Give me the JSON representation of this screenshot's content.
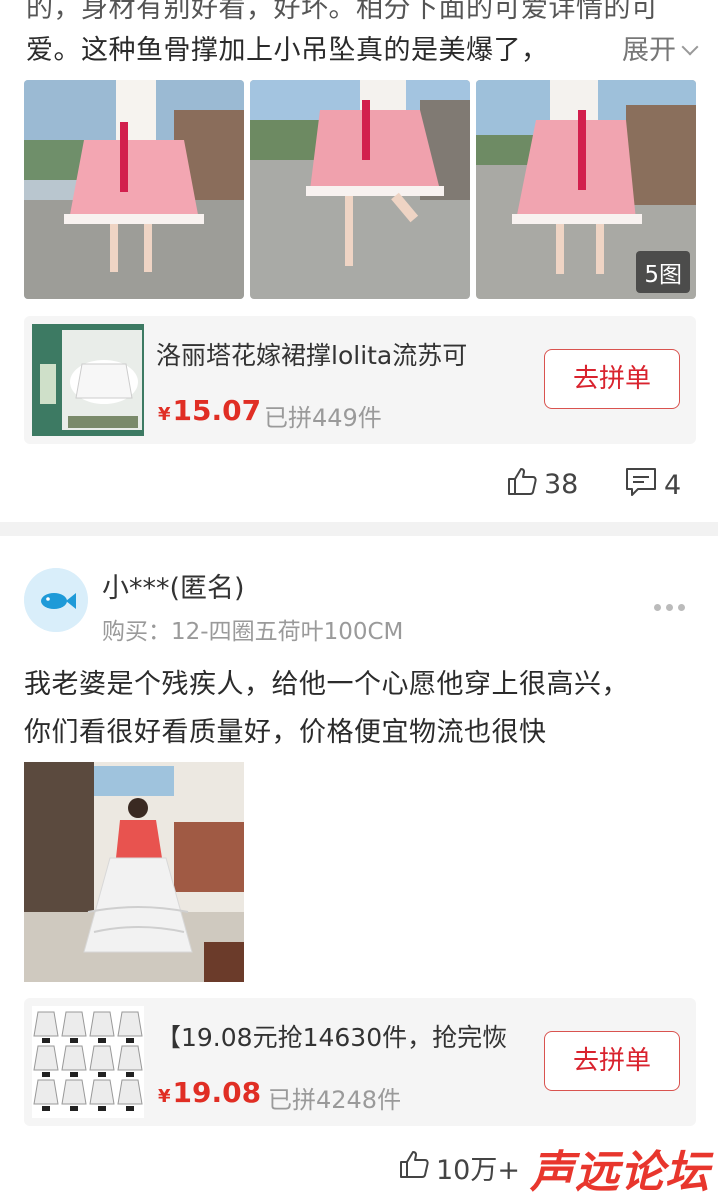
{
  "review1": {
    "cut_text": "的，身材有别好看，好坏。相分下面的可爱详情的可",
    "text_line2": "爱。这种鱼骨撑加上小吊坠真的是美爆了，",
    "expand_label": "展开",
    "image_count": "5图",
    "product": {
      "title": "洛丽塔花嫁裙撑lolita流苏可",
      "currency": "¥",
      "price": "15.07",
      "sold": "已拼449件",
      "button": "去拼单"
    },
    "likes": "38",
    "comments": "4"
  },
  "review2": {
    "username": "小***(匿名)",
    "purchase": "购买：12-四圈五荷叶100CM",
    "text_line1": "我老婆是个残疾人，给他一个心愿他穿上很高兴，",
    "text_line2": "你们看很好看质量好，价格便宜物流也很快",
    "product": {
      "title": "【19.08元抢14630件，抢完恢",
      "currency": "¥",
      "price": "19.08",
      "sold": "已拼4248件",
      "button": "去拼单"
    },
    "likes": "10万+"
  },
  "watermark": "声远论坛",
  "colors": {
    "price_red": "#e02e24",
    "button_border": "#d9534f",
    "card_bg": "#f5f5f5",
    "divider": "#f2f2f2"
  },
  "icons": [
    "thumbs-up-icon",
    "comment-icon",
    "more-dots-icon",
    "chevron-down-icon",
    "fish-avatar-icon"
  ]
}
